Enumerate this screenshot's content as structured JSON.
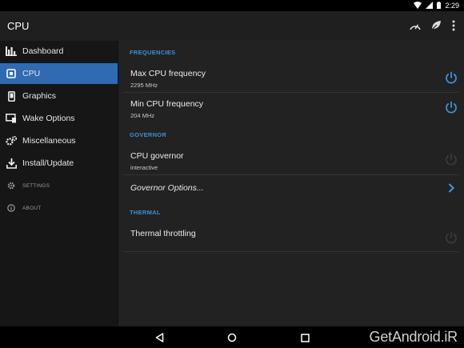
{
  "status": {
    "time": "2:29"
  },
  "app": {
    "title": "CPU"
  },
  "sidebar": {
    "items": [
      {
        "label": "Dashboard"
      },
      {
        "label": "CPU"
      },
      {
        "label": "Graphics"
      },
      {
        "label": "Wake Options"
      },
      {
        "label": "Miscellaneous"
      },
      {
        "label": "Install/Update"
      },
      {
        "label": "SETTINGS"
      },
      {
        "label": "ABOUT"
      }
    ]
  },
  "sections": {
    "frequencies": "FREQUENCIES",
    "governor": "GOVERNOR",
    "thermal": "THERMAL"
  },
  "rows": {
    "max_freq": {
      "title": "Max CPU frequency",
      "value": "2295 MHz"
    },
    "min_freq": {
      "title": "Min CPU frequency",
      "value": "204 MHz"
    },
    "cpu_governor": {
      "title": "CPU governor",
      "value": "interactive"
    },
    "governor_options": {
      "title": "Governor Options..."
    },
    "thermal_throttling": {
      "title": "Thermal throttling"
    }
  },
  "watermark": "GetAndroid.iR",
  "colors": {
    "accent": "#3d8fd8",
    "active_nav": "#2f6ab3",
    "background": "#222222",
    "sidebar": "#161616"
  }
}
